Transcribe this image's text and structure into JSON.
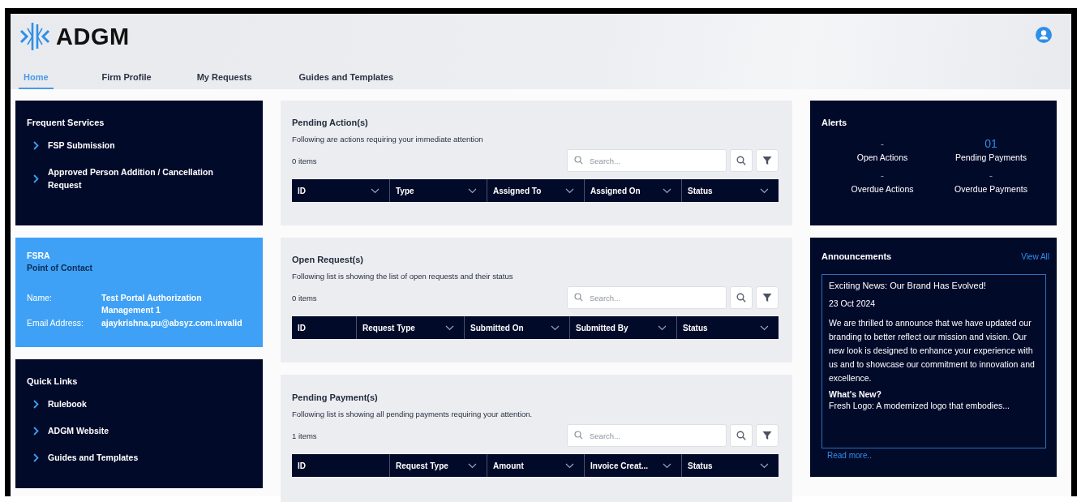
{
  "header": {
    "logo_text": "ADGM"
  },
  "tabs": [
    {
      "label": "Home",
      "selected": true
    },
    {
      "label": "Firm Profile",
      "selected": false
    },
    {
      "label": "My Requests",
      "selected": false
    },
    {
      "label": "Guides and Templates",
      "selected": false
    }
  ],
  "frequent_services": {
    "title": "Frequent Services",
    "items": [
      "FSP Submission",
      "Approved Person Addition / Cancellation Request"
    ]
  },
  "contact": {
    "org": "FSRA",
    "title": "Point of Contact",
    "fields": [
      {
        "label": "Name:",
        "value": "Test Portal Authorization Management 1"
      },
      {
        "label": "Email Address:",
        "value": "ajaykrishna.pu@absyz.com.invalid"
      }
    ]
  },
  "quick_links": {
    "title": "Quick Links",
    "items": [
      "Rulebook",
      "ADGM Website",
      "Guides and Templates"
    ]
  },
  "panels": [
    {
      "title": "Pending Action(s)",
      "subtitle": "Following are actions requiring your immediate attention",
      "count": "0 items",
      "search_placeholder": "Search...",
      "columns": [
        {
          "label": "ID",
          "menu": true
        },
        {
          "label": "Type",
          "menu": true
        },
        {
          "label": "Assigned To",
          "menu": true
        },
        {
          "label": "Assigned On",
          "menu": true
        },
        {
          "label": "Status",
          "menu": true
        }
      ]
    },
    {
      "title": "Open Request(s)",
      "subtitle": "Following list is showing the list of open requests and their status",
      "count": "0 items",
      "search_placeholder": "Search...",
      "columns": [
        {
          "label": "ID",
          "menu": false
        },
        {
          "label": "Request Type",
          "menu": true
        },
        {
          "label": "Submitted On",
          "menu": true
        },
        {
          "label": "Submitted By",
          "menu": true
        },
        {
          "label": "Status",
          "menu": true
        }
      ]
    },
    {
      "title": "Pending Payment(s)",
      "subtitle": "Following list is showing all pending payments requiring your attention.",
      "count": "1 items",
      "search_placeholder": "Search...",
      "columns": [
        {
          "label": "ID",
          "menu": false
        },
        {
          "label": "Request Type",
          "menu": true
        },
        {
          "label": "Amount",
          "menu": true
        },
        {
          "label": "Invoice Creat...",
          "menu": true
        },
        {
          "label": "Status",
          "menu": true
        }
      ]
    }
  ],
  "alerts": {
    "title": "Alerts",
    "items": [
      {
        "value": "-",
        "label": "Open Actions",
        "highlighted": false
      },
      {
        "value": "01",
        "label": "Pending Payments",
        "highlighted": true
      },
      {
        "value": "-",
        "label": "Overdue Actions",
        "highlighted": false
      },
      {
        "value": "-",
        "label": "Overdue Payments",
        "highlighted": false
      }
    ]
  },
  "announcements": {
    "title": "Announcements",
    "view_all": "View All",
    "headline": "Exciting News: Our Brand Has Evolved!",
    "date": "23 Oct 2024",
    "body": "We are thrilled to announce that we have updated our branding to better reflect our mission and vision. Our new look is designed to enhance your experience with us and to showcase our commitment to innovation and excellence.",
    "subheading": "What's New?",
    "teaser": "Fresh Logo: A modernized logo that embodies...",
    "read_more": "Read more.."
  }
}
